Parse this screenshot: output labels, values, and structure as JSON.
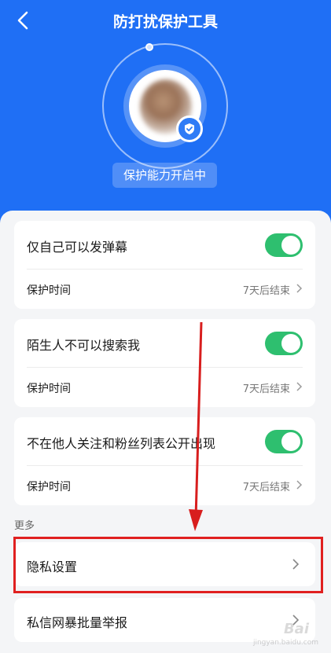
{
  "header": {
    "title": "防打扰保护工具",
    "back_icon": "chevron-left-icon",
    "status": "保护能力开启中",
    "bg_color": "#1f6ff5"
  },
  "settings": [
    {
      "label": "仅自己可以发弹幕",
      "enabled": true,
      "time_label": "保护时间",
      "time_value": "7天后结束"
    },
    {
      "label": "陌生人不可以搜索我",
      "enabled": true,
      "time_label": "保护时间",
      "time_value": "7天后结束"
    },
    {
      "label": "不在他人关注和粉丝列表公开出现",
      "enabled": true,
      "time_label": "保护时间",
      "time_value": "7天后结束"
    }
  ],
  "more": {
    "section_label": "更多",
    "items": [
      {
        "label": "隐私设置"
      },
      {
        "label": "私信网暴批量举报"
      }
    ]
  },
  "colors": {
    "toggle_on": "#2ebf6f",
    "annotation_red": "#e02020"
  },
  "watermark": {
    "text": "Bai",
    "sub": "jingyan.baidu.com"
  }
}
